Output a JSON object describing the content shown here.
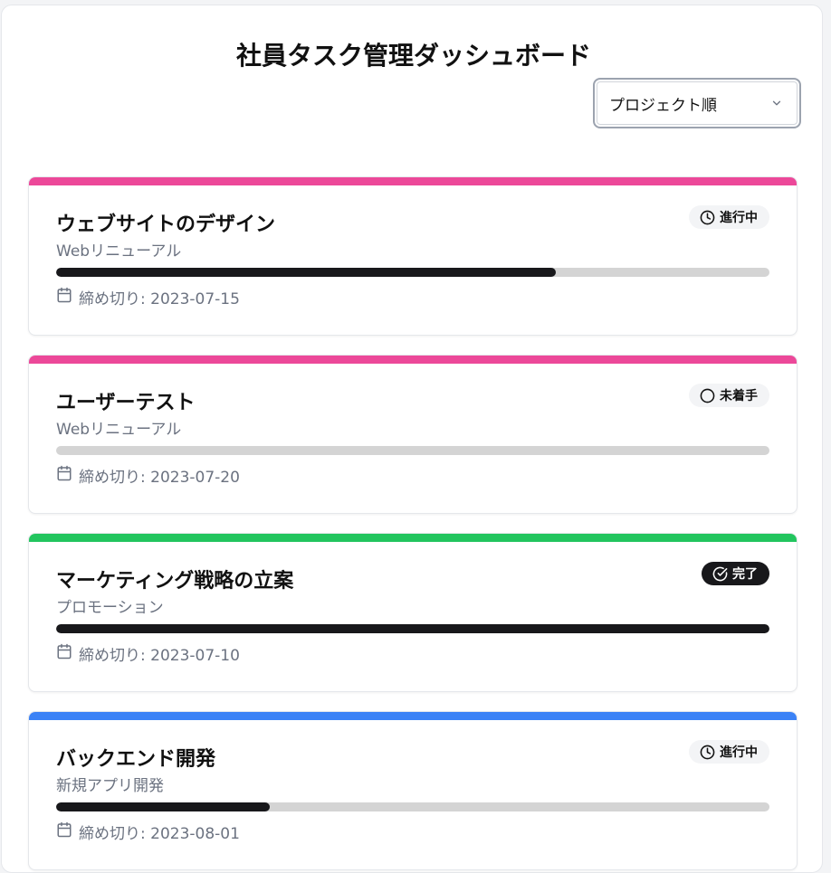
{
  "page": {
    "title": "社員タスク管理ダッシュボード"
  },
  "sort": {
    "selected": "プロジェクト順"
  },
  "colors": {
    "pink": "#ec4899",
    "green": "#22c55e",
    "blue": "#3b82f6",
    "progress_fill": "#18181b",
    "progress_track": "#d4d4d4"
  },
  "tasks": [
    {
      "title": "ウェブサイトのデザイン",
      "project": "Webリニューアル",
      "status": "進行中",
      "status_icon": "clock-icon",
      "progress": 0.7,
      "deadline": "締め切り: 2023-07-15",
      "accent": "#ec4899"
    },
    {
      "title": "ユーザーテスト",
      "project": "Webリニューアル",
      "status": "未着手",
      "status_icon": "circle-icon",
      "progress": 0,
      "deadline": "締め切り: 2023-07-20",
      "accent": "#ec4899"
    },
    {
      "title": "マーケティング戦略の立案",
      "project": "プロモーション",
      "status": "完了",
      "status_icon": "check-circle-icon",
      "progress": 1,
      "deadline": "締め切り: 2023-07-10",
      "accent": "#22c55e"
    },
    {
      "title": "バックエンド開発",
      "project": "新規アプリ開発",
      "status": "進行中",
      "status_icon": "clock-icon",
      "progress": 0.3,
      "deadline": "締め切り: 2023-08-01",
      "accent": "#3b82f6"
    }
  ]
}
